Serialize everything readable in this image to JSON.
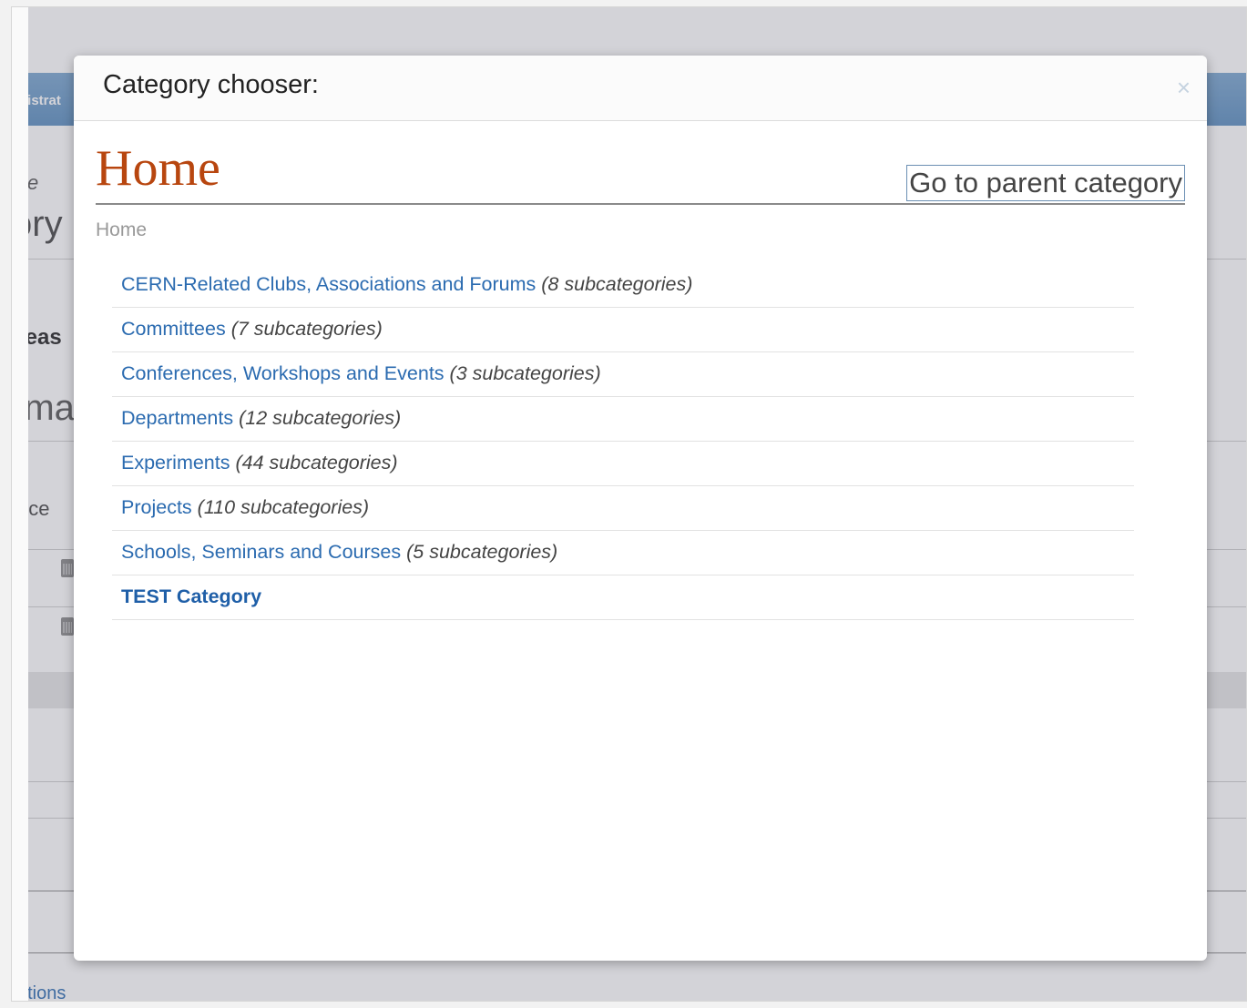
{
  "background": {
    "nav_text": "nistrat",
    "fragments": [
      "ce",
      "ory",
      "leas",
      "rma",
      "nce",
      "ations"
    ]
  },
  "modal": {
    "title": "Category chooser:",
    "close_symbol": "×",
    "category_title": "Home",
    "parent_button_label": "Go to parent category",
    "breadcrumb": "Home",
    "items": [
      {
        "name": "CERN-Related Clubs, Associations and Forums",
        "count": "(8 subcategories)"
      },
      {
        "name": "Committees",
        "count": "(7 subcategories)"
      },
      {
        "name": "Conferences, Workshops and Events",
        "count": "(3 subcategories)"
      },
      {
        "name": "Departments",
        "count": "(12 subcategories)"
      },
      {
        "name": "Experiments",
        "count": "(44 subcategories)"
      },
      {
        "name": "Projects",
        "count": "(110 subcategories)"
      },
      {
        "name": "Schools, Seminars and Courses",
        "count": "(5 subcategories)"
      },
      {
        "name": "TEST Category",
        "count": ""
      }
    ]
  },
  "colors": {
    "category_title": "#b8460f",
    "link": "#2b6bb0"
  }
}
